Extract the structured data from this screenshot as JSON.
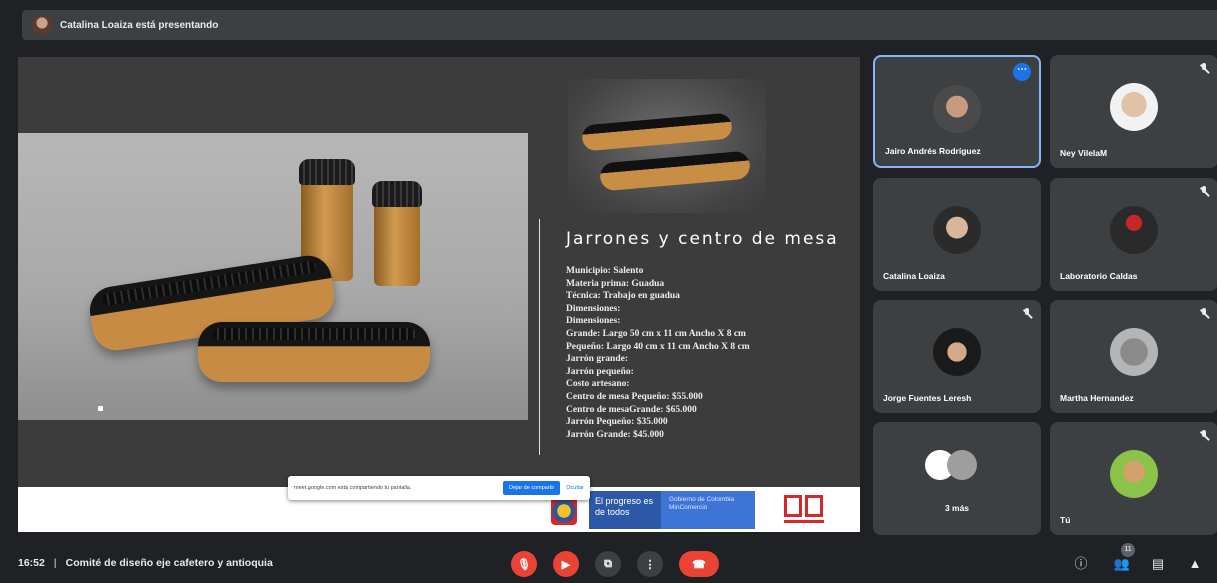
{
  "presenter_bar": {
    "text": "Catalina Loaiza está presentando"
  },
  "slide": {
    "title": "Jarrones y centro de mesa",
    "details": [
      "Municipio: Salento",
      "Materia prima: Guadua",
      "Técnica: Trabajo en guadua",
      "Dimensiones:",
      "Dimensiones:",
      "Grande: Largo 50 cm x 11 cm  Ancho X  8 cm",
      "Pequeño: Largo 40 cm x 11 cm  Ancho X  8 cm",
      "Jarrón grande:",
      "Jarrón pequeño:",
      "Costo artesano:",
      "Centro de mesa Pequeño: $55.000",
      "Centro de mesaGrande: $65.000",
      "Jarrón Pequeño: $35.000",
      "Jarrón Grande: $45.000"
    ],
    "footer": {
      "progress_text": "El progreso es de todos",
      "ministry_text": "Gobierno de Colombia MinComercio"
    }
  },
  "share_banner": {
    "text": "meet.google.com está compartiendo tu pantalla.",
    "stop_label": "Dejar de compartir",
    "hide_label": "Ocultar"
  },
  "participants": [
    {
      "name": "Jairo Andrés Rodríguez",
      "active": true
    },
    {
      "name": "Ney VilelaM",
      "muted": true
    },
    {
      "name": "Catalina Loaiza"
    },
    {
      "name": "Laboratorio Caldas",
      "muted": true
    },
    {
      "name": "Jorge Fuentes Leresh",
      "muted": true
    },
    {
      "name": "Martha Hernandez",
      "muted": true
    },
    {
      "name": "3 más"
    },
    {
      "name": "Tú",
      "muted": true
    }
  ],
  "bottom_bar": {
    "time": "16:52",
    "separator": "|",
    "meeting_title": "Comité de diseño eje cafetero y antioquia",
    "participant_count": "11"
  },
  "icons": {
    "presenter_avatar": "avatar",
    "more": "more-options-icon",
    "mic_off": "mic-off-icon",
    "camera_off": "camera-off-icon",
    "present": "present-screen-icon",
    "more_vert": "more-vert-icon",
    "hangup": "hang-up-icon",
    "info": "info-icon",
    "people": "people-icon",
    "chat": "chat-icon",
    "activities": "activities-icon"
  },
  "colors": {
    "accent": "#1a73e8",
    "danger": "#ea4335",
    "tile": "#3c4043",
    "background": "#202124"
  }
}
